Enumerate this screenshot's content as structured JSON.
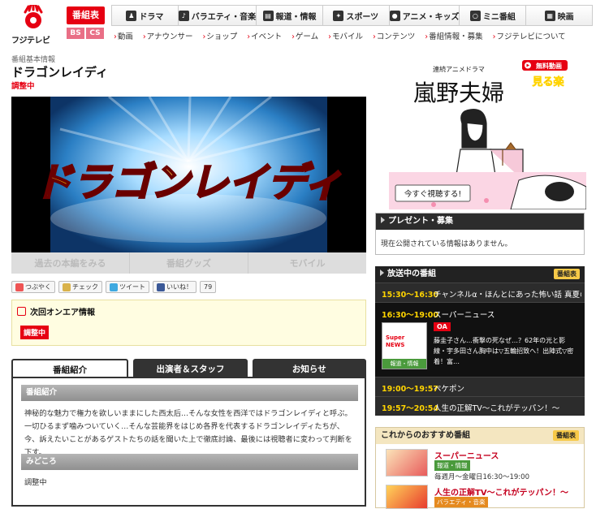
{
  "header": {
    "logo_text": "フジテレビ",
    "bangumi_label": "番組表",
    "bs_label": "BS",
    "cs_label": "CS",
    "global_nav": [
      {
        "label": "ドラマ",
        "icon": "drama-icon"
      },
      {
        "label": "バラエティ・音楽",
        "icon": "mic-icon"
      },
      {
        "label": "報道・情報",
        "icon": "news-icon"
      },
      {
        "label": "スポーツ",
        "icon": "sports-icon"
      },
      {
        "label": "アニメ・キッズ",
        "icon": "bear-icon"
      },
      {
        "label": "ミニ番組",
        "icon": "magnifier-icon"
      },
      {
        "label": "映画",
        "icon": "film-icon"
      }
    ],
    "sub_nav": [
      "動画",
      "アナウンサー",
      "ショップ",
      "イベント",
      "ゲーム",
      "モバイル",
      "コンテンツ",
      "番組情報・募集",
      "フジテレビについて"
    ]
  },
  "program": {
    "crumb": "番組基本情報",
    "title": "ドラゴンレイディ",
    "status": "調整中",
    "hero_logo_text": "ドラゴンレイディ",
    "hero_buttons": [
      "過去の本編をみる",
      "番組グッズ",
      "モバイル"
    ],
    "social": [
      {
        "label": "つぶやく"
      },
      {
        "label": "チェック"
      },
      {
        "label": "ツイート"
      },
      {
        "label": "いいね！"
      },
      {
        "label": "79"
      }
    ],
    "next_air": {
      "heading": "次回オンエア情報",
      "badge": "調整中"
    },
    "tabs": [
      "番組紹介",
      "出演者＆スタッフ",
      "お知らせ"
    ],
    "sections": [
      {
        "heading": "番組紹介",
        "body": "神秘的な魅力で権力を欲しいままにした西太后…そんな女性を西洋ではドラゴンレイディと呼ぶ。一切ひるまず噛みついていく…そんな芸能界をはじめ各界を代表するドラゴンレイディたちが、今、訴えたいことがあるゲストたちの話を聞いた上で徹底討論、最後には視聴者に変わって判断を下す。"
      },
      {
        "heading": "みどころ",
        "body": "調整中"
      }
    ]
  },
  "sidebar": {
    "ad": {
      "subtitle": "連続アニメドラマ",
      "title": "嵐野夫婦",
      "free_label": "無料動画",
      "mitemi_label": "見る楽",
      "cta": "今すぐ視聴する!"
    },
    "present": {
      "heading": "プレゼント・募集",
      "body": "現在公開されている情報はありません。"
    },
    "onair": {
      "heading": "放送中の番組",
      "tag": "番組表",
      "rows": [
        {
          "time": "15:30〜16:30",
          "title": "チャンネルα・ほんとにあった怖い話 真夏の"
        },
        {
          "time": "16:30〜19:00",
          "title": "スーパーニュース",
          "badge": "OA",
          "genre": "報道・情報",
          "desc": "藤圭子さん…衝撃の死なぜ…？62年の光と影線・宇多田さん胸中は▽五輪招致へ！出陣式▽密着！富…",
          "thumb_text": "Super NEWS"
        },
        {
          "time": "19:00〜19:57",
          "title": "ペケポン"
        },
        {
          "time": "19:57〜20:54",
          "title": "人生の正解TV〜これがテッパン！〜"
        }
      ]
    },
    "reco": {
      "heading": "これからのおすすめ番組",
      "tag": "番組表",
      "items": [
        {
          "title": "スーパーニュース",
          "genre": "報道・情報",
          "time": "毎週月〜金曜日16:30〜19:00"
        },
        {
          "title": "人生の正解TV〜これがテッパン！〜",
          "genre": "バラエティ・音楽"
        }
      ]
    }
  }
}
